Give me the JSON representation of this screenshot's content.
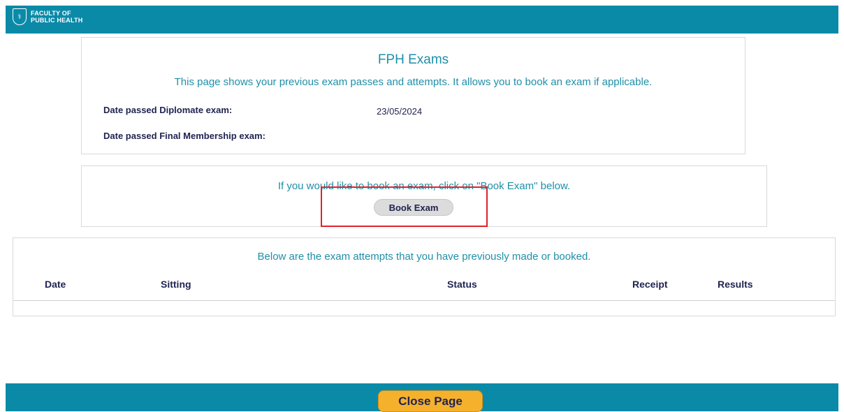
{
  "header": {
    "logo_line1": "FACULTY OF",
    "logo_line2": "PUBLIC HEALTH",
    "logo_icon": "shield-crest-icon"
  },
  "exams": {
    "title": "FPH Exams",
    "intro": "This page shows your previous exam passes and attempts. It allows you to book an exam if applicable.",
    "rows": [
      {
        "label": "Date passed Diplomate exam:",
        "value": "23/05/2024"
      },
      {
        "label": "Date passed Final Membership exam:",
        "value": ""
      }
    ]
  },
  "booking": {
    "text": "If you would like to book an exam, click on \"Book Exam\" below.",
    "button_label": "Book Exam"
  },
  "attempts": {
    "text": "Below are the exam attempts that you have previously made or booked.",
    "columns": [
      "Date",
      "Sitting",
      "Status",
      "Receipt",
      "Results"
    ],
    "rows": []
  },
  "footer": {
    "close_label": "Close Page"
  },
  "colors": {
    "brand_teal": "#0b8aa8",
    "accent_orange": "#f6b12c",
    "highlight_red": "#e0222a",
    "heading_text": "#1f8fa8",
    "label_text": "#1f2350"
  }
}
